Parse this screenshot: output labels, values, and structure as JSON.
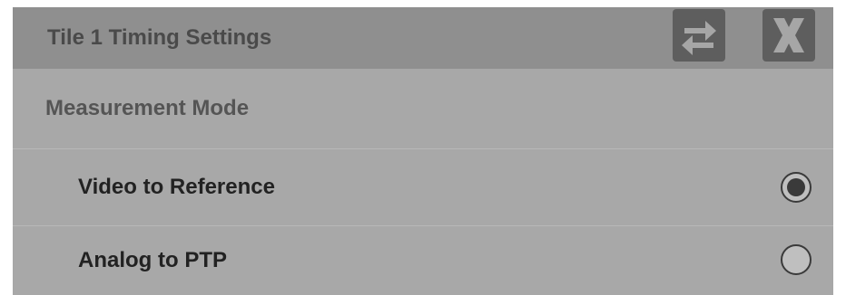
{
  "dialog": {
    "title": "Tile 1 Timing Settings",
    "buttons": [
      {
        "name": "swap",
        "icon": "swap-arrows-icon"
      },
      {
        "name": "close",
        "icon": "close-x-icon"
      }
    ]
  },
  "section": {
    "label": "Measurement Mode"
  },
  "options": [
    {
      "label": "Video to Reference",
      "selected": true
    },
    {
      "label": "Analog to PTP",
      "selected": false
    }
  ],
  "colors": {
    "panel": "#a8a8a8",
    "titlebar": "#8f8f8f",
    "button": "#5e5e5e",
    "icon": "#a6a6a6"
  }
}
